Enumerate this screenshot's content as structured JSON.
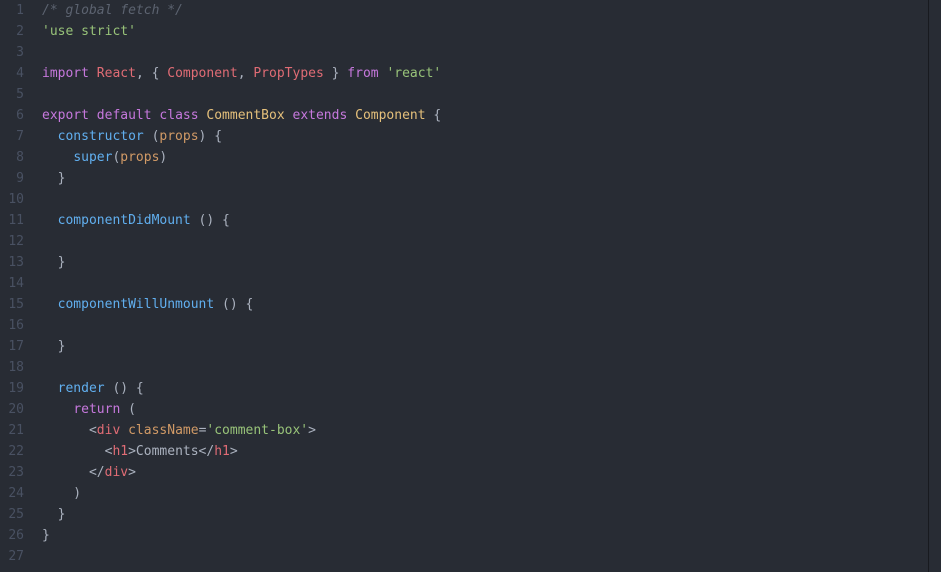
{
  "lines": [
    {
      "n": 1,
      "tokens": [
        [
          "c-comment",
          "/* global fetch */"
        ]
      ]
    },
    {
      "n": 2,
      "tokens": [
        [
          "c-string",
          "'use strict'"
        ]
      ]
    },
    {
      "n": 3,
      "tokens": []
    },
    {
      "n": 4,
      "tokens": [
        [
          "c-keyword",
          "import"
        ],
        [
          "c-plain",
          " "
        ],
        [
          "c-def",
          "React"
        ],
        [
          "c-plain",
          ", { "
        ],
        [
          "c-def",
          "Component"
        ],
        [
          "c-plain",
          ", "
        ],
        [
          "c-def",
          "PropTypes"
        ],
        [
          "c-plain",
          " } "
        ],
        [
          "c-keyword",
          "from"
        ],
        [
          "c-plain",
          " "
        ],
        [
          "c-string",
          "'react'"
        ]
      ]
    },
    {
      "n": 5,
      "tokens": []
    },
    {
      "n": 6,
      "tokens": [
        [
          "c-keyword",
          "export"
        ],
        [
          "c-plain",
          " "
        ],
        [
          "c-keyword",
          "default"
        ],
        [
          "c-plain",
          " "
        ],
        [
          "c-keyword",
          "class"
        ],
        [
          "c-plain",
          " "
        ],
        [
          "c-class",
          "CommentBox"
        ],
        [
          "c-plain",
          " "
        ],
        [
          "c-keyword",
          "extends"
        ],
        [
          "c-plain",
          " "
        ],
        [
          "c-class",
          "Component"
        ],
        [
          "c-plain",
          " {"
        ]
      ]
    },
    {
      "n": 7,
      "tokens": [
        [
          "c-plain",
          "  "
        ],
        [
          "c-func",
          "constructor"
        ],
        [
          "c-plain",
          " ("
        ],
        [
          "c-prop",
          "props"
        ],
        [
          "c-plain",
          ") {"
        ]
      ]
    },
    {
      "n": 8,
      "tokens": [
        [
          "c-plain",
          "    "
        ],
        [
          "c-func",
          "super"
        ],
        [
          "c-plain",
          "("
        ],
        [
          "c-prop",
          "props"
        ],
        [
          "c-plain",
          ")"
        ]
      ]
    },
    {
      "n": 9,
      "tokens": [
        [
          "c-plain",
          "  }"
        ]
      ]
    },
    {
      "n": 10,
      "tokens": []
    },
    {
      "n": 11,
      "tokens": [
        [
          "c-plain",
          "  "
        ],
        [
          "c-func",
          "componentDidMount"
        ],
        [
          "c-plain",
          " () {"
        ]
      ]
    },
    {
      "n": 12,
      "tokens": []
    },
    {
      "n": 13,
      "tokens": [
        [
          "c-plain",
          "  }"
        ]
      ]
    },
    {
      "n": 14,
      "tokens": []
    },
    {
      "n": 15,
      "tokens": [
        [
          "c-plain",
          "  "
        ],
        [
          "c-func",
          "componentWillUnmount"
        ],
        [
          "c-plain",
          " () {"
        ]
      ]
    },
    {
      "n": 16,
      "tokens": []
    },
    {
      "n": 17,
      "tokens": [
        [
          "c-plain",
          "  }"
        ]
      ]
    },
    {
      "n": 18,
      "tokens": []
    },
    {
      "n": 19,
      "tokens": [
        [
          "c-plain",
          "  "
        ],
        [
          "c-func",
          "render"
        ],
        [
          "c-plain",
          " () {"
        ]
      ]
    },
    {
      "n": 20,
      "tokens": [
        [
          "c-plain",
          "    "
        ],
        [
          "c-keyword",
          "return"
        ],
        [
          "c-plain",
          " ("
        ]
      ]
    },
    {
      "n": 21,
      "tokens": [
        [
          "c-plain",
          "      <"
        ],
        [
          "c-tag",
          "div"
        ],
        [
          "c-plain",
          " "
        ],
        [
          "c-attr",
          "className"
        ],
        [
          "c-plain",
          "="
        ],
        [
          "c-string",
          "'comment-box'"
        ],
        [
          "c-plain",
          ">"
        ]
      ]
    },
    {
      "n": 22,
      "tokens": [
        [
          "c-plain",
          "        <"
        ],
        [
          "c-tag",
          "h1"
        ],
        [
          "c-plain",
          ">Comments</"
        ],
        [
          "c-tag",
          "h1"
        ],
        [
          "c-plain",
          ">"
        ]
      ]
    },
    {
      "n": 23,
      "tokens": [
        [
          "c-plain",
          "      </"
        ],
        [
          "c-tag",
          "div"
        ],
        [
          "c-plain",
          ">"
        ]
      ]
    },
    {
      "n": 24,
      "tokens": [
        [
          "c-plain",
          "    )"
        ]
      ]
    },
    {
      "n": 25,
      "tokens": [
        [
          "c-plain",
          "  }"
        ]
      ]
    },
    {
      "n": 26,
      "tokens": [
        [
          "c-plain",
          "}"
        ]
      ]
    },
    {
      "n": 27,
      "tokens": []
    }
  ]
}
